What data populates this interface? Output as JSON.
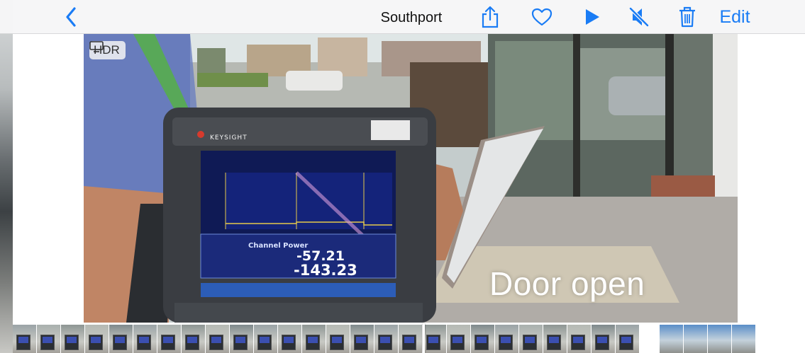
{
  "nav": {
    "title": "Southport",
    "edit_label": "Edit",
    "icons": [
      "chevron-left-icon",
      "share-icon",
      "heart-icon",
      "play-icon",
      "speaker-muted-icon",
      "trash-icon"
    ],
    "accent_color": "#1a7cf5"
  },
  "photo": {
    "hdr_label": "HDR",
    "caption": "Door open",
    "device": {
      "brand": "KEYSIGHT",
      "channel_power_label": "Channel Power",
      "channel_power_value": "-57.21",
      "psd_value": "-143.23"
    }
  },
  "filmstrip": {
    "thumbnail_count": 30
  }
}
